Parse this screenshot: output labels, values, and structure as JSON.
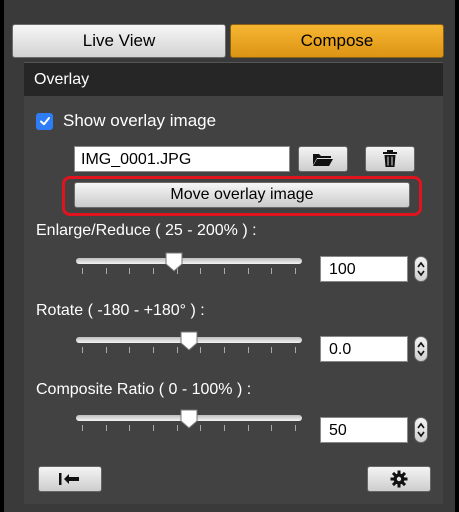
{
  "tabs": [
    {
      "label": "Live View",
      "active": false
    },
    {
      "label": "Compose",
      "active": true
    }
  ],
  "section": {
    "title": "Overlay"
  },
  "overlay": {
    "show_label": "Show overlay image",
    "show_checked": true,
    "file_name": "IMG_0001.JPG",
    "open_icon": "folder-icon",
    "delete_icon": "trash-icon",
    "move_label": "Move overlay image",
    "highlight_color": "#e0141e"
  },
  "enlarge": {
    "label": "Enlarge/Reduce ( 25 - 200% ) :",
    "value": "100",
    "min": 25,
    "max": 200,
    "level": 100
  },
  "rotate": {
    "label": "Rotate ( -180 - +180° ) :",
    "value": "0.0",
    "min": -180,
    "max": 180,
    "level": 0
  },
  "composite": {
    "label": "Composite Ratio ( 0 - 100% ) :",
    "value": "50",
    "min": 0,
    "max": 100,
    "level": 50
  },
  "bottom": {
    "reset_icon": "reset-arrow-icon",
    "settings_icon": "gear-icon"
  },
  "colors": {
    "accent": "#f0a523",
    "panel": "#424242",
    "checkbox": "#2e7cf6"
  }
}
